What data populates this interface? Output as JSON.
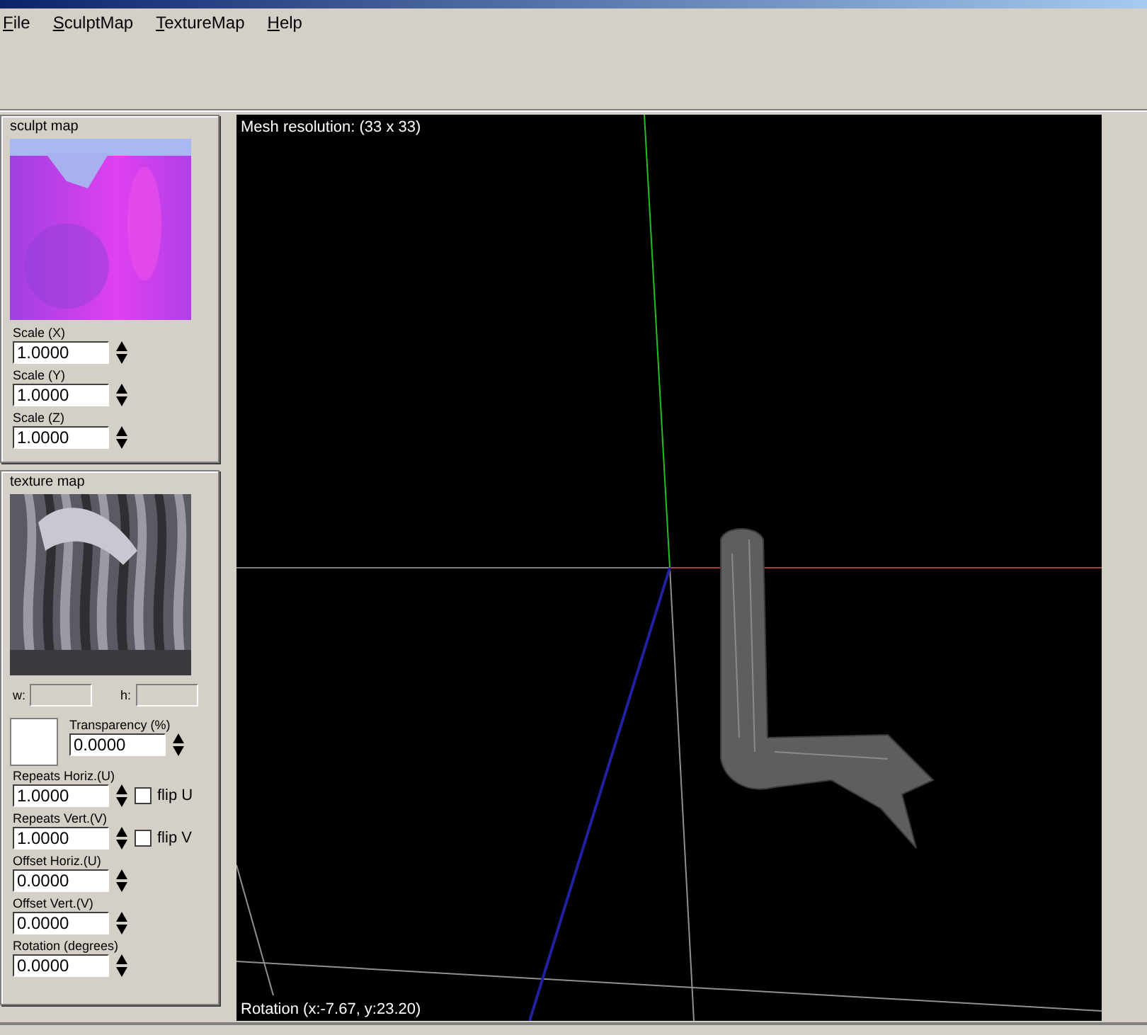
{
  "menu": [
    {
      "label": "File"
    },
    {
      "label": "SculptMap"
    },
    {
      "label": "TextureMap"
    },
    {
      "label": "Help"
    }
  ],
  "sculpt_panel": {
    "title": "sculpt map",
    "fields": [
      {
        "label": "Scale (X)",
        "value": "1.0000"
      },
      {
        "label": "Scale (Y)",
        "value": "1.0000"
      },
      {
        "label": "Scale (Z)",
        "value": "1.0000"
      }
    ]
  },
  "texture_panel": {
    "title": "texture map",
    "width_label": "w:",
    "height_label": "h:",
    "transparency": {
      "label": "Transparency (%)",
      "value": "0.0000"
    },
    "fields": [
      {
        "label": "Repeats Horiz.(U)",
        "value": "1.0000",
        "flip": {
          "label": "flip U",
          "checked": false
        }
      },
      {
        "label": "Repeats Vert.(V)",
        "value": "1.0000",
        "flip": {
          "label": "flip V",
          "checked": false
        }
      },
      {
        "label": "Offset Horiz.(U)",
        "value": "0.0000"
      },
      {
        "label": "Offset Vert.(V)",
        "value": "0.0000"
      },
      {
        "label": "Rotation (degrees)",
        "value": "0.0000"
      }
    ]
  },
  "viewport": {
    "mesh_resolution": "Mesh resolution: (33 x 33)",
    "rotation": "Rotation (x:-7.67, y:23.20)"
  }
}
